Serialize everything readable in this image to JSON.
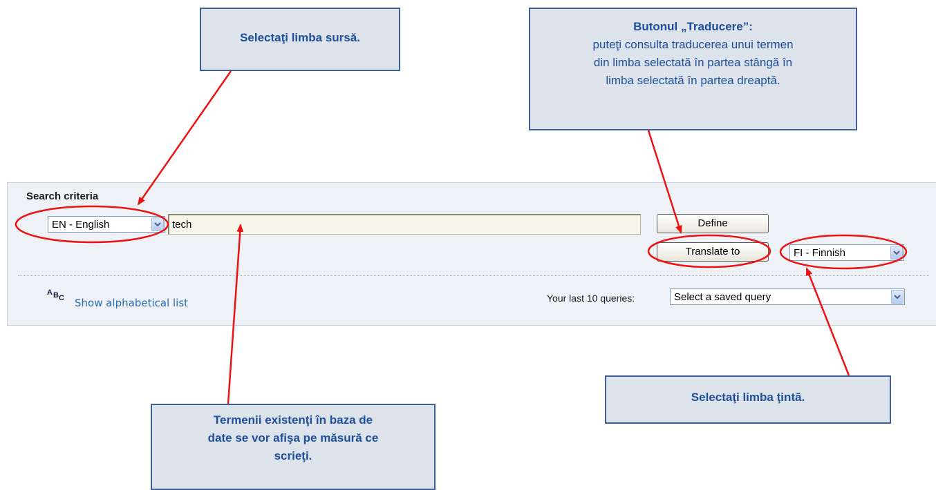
{
  "callouts": {
    "source_language": {
      "text": "Selectaţi limba sursă."
    },
    "translate_button": {
      "title": "Butonul „Traducere”:",
      "lines": [
        "puteţi consulta traducerea unui termen",
        "din limba selectată în partea stângă în",
        "limba selectată în partea dreaptă."
      ]
    },
    "target_language": {
      "text": "Selectaţi limba ţintă."
    },
    "existing_terms": {
      "lines": [
        "Termenii existenţi în baza de",
        "date se vor afişa pe măsură ce",
        "scrieţi."
      ]
    }
  },
  "search_panel": {
    "title": "Search criteria",
    "source_language": "EN - English",
    "search_term": "tech",
    "define_label": "Define",
    "translate_label": "Translate to",
    "target_language": "FI - Finnish",
    "alpha_icon_text": "ABC",
    "alpha_list_label": "Show alphabetical list",
    "last_queries_label": "Your last 10 queries:",
    "saved_query_value": "Select a saved query"
  },
  "colors": {
    "callout_fill": "#dce3eb",
    "callout_border": "#3c5f9a",
    "callout_text": "#1f4e9a",
    "annotation_red": "#ee1111",
    "panel_background": "#eef2f6",
    "link_blue": "#2a6bb5"
  },
  "icons": {
    "dropdown_arrow": "chevron-down-icon",
    "alphabet": "abc-icon"
  }
}
